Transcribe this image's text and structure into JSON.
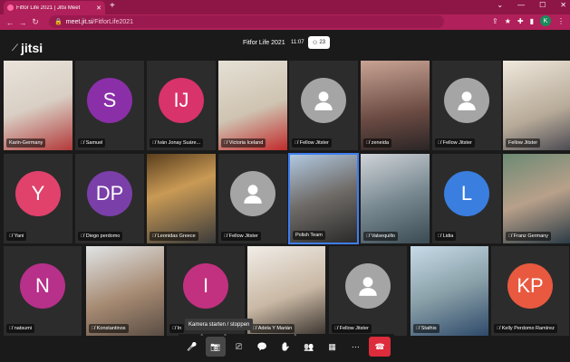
{
  "browser": {
    "tab_title": "Fitfor Life 2021 | Jitsi Meet",
    "url_host": "meet.jit.si",
    "url_path": "/FitforLife2021",
    "profile_initial": "K"
  },
  "header": {
    "logo_text": "jitsi",
    "meeting_title": "Fitfor Life 2021",
    "timer": "11:07",
    "participant_count": "23"
  },
  "colors": {
    "accent": "#b0205a",
    "active_border": "#3f7ef0",
    "hangup": "#dd2c3b"
  },
  "tiles": [
    {
      "name": "Karin-Germany",
      "muted": false,
      "type": "video",
      "initials": ""
    },
    {
      "name": "Samuel",
      "muted": true,
      "type": "avatar",
      "initials": "S"
    },
    {
      "name": "Iván Jonay Suáre...",
      "muted": true,
      "type": "avatar",
      "initials": "IJ"
    },
    {
      "name": "Victoria Iceland",
      "muted": true,
      "type": "video",
      "initials": ""
    },
    {
      "name": "Fellow Jitster",
      "muted": true,
      "type": "generic",
      "initials": ""
    },
    {
      "name": "zeneida",
      "muted": true,
      "type": "video",
      "initials": ""
    },
    {
      "name": "Fellow Jitster",
      "muted": true,
      "type": "generic",
      "initials": ""
    },
    {
      "name": "Fellow Jitster",
      "muted": false,
      "type": "video",
      "initials": ""
    },
    {
      "name": "Yani",
      "muted": true,
      "type": "avatar",
      "initials": "Y"
    },
    {
      "name": "Diego perdomo",
      "muted": true,
      "type": "avatar",
      "initials": "DP"
    },
    {
      "name": "Leonidas Greece",
      "muted": true,
      "type": "video",
      "initials": ""
    },
    {
      "name": "Fellow Jitster",
      "muted": true,
      "type": "generic",
      "initials": ""
    },
    {
      "name": "Polish Team",
      "muted": false,
      "type": "video",
      "initials": ""
    },
    {
      "name": "Valsequillo",
      "muted": true,
      "type": "video",
      "initials": ""
    },
    {
      "name": "Lidia",
      "muted": true,
      "type": "avatar",
      "initials": "L"
    },
    {
      "name": "Franz Germany",
      "muted": true,
      "type": "video",
      "initials": ""
    },
    {
      "name": "natsumi",
      "muted": true,
      "type": "avatar",
      "initials": "N"
    },
    {
      "name": "Konstantinos",
      "muted": true,
      "type": "video",
      "initials": ""
    },
    {
      "name": "In",
      "muted": true,
      "type": "avatar",
      "initials": "I"
    },
    {
      "name": "Adela Y Marián",
      "muted": true,
      "type": "video",
      "initials": ""
    },
    {
      "name": "Fellow Jitster",
      "muted": true,
      "type": "generic",
      "initials": ""
    },
    {
      "name": "Stathis",
      "muted": true,
      "type": "video",
      "initials": ""
    },
    {
      "name": "Kelly Perdomo Ramírez",
      "muted": true,
      "type": "avatar",
      "initials": "KP"
    }
  ],
  "toolbar": {
    "tooltip": "Kamera starten / stoppen",
    "buttons": [
      {
        "icon": "microphone-icon"
      },
      {
        "icon": "camera-icon"
      },
      {
        "icon": "screen-share-icon"
      },
      {
        "icon": "chat-icon"
      },
      {
        "icon": "raise-hand-icon"
      },
      {
        "icon": "participants-icon"
      },
      {
        "icon": "tile-view-icon"
      },
      {
        "icon": "more-icon"
      },
      {
        "icon": "hangup-icon"
      }
    ]
  }
}
